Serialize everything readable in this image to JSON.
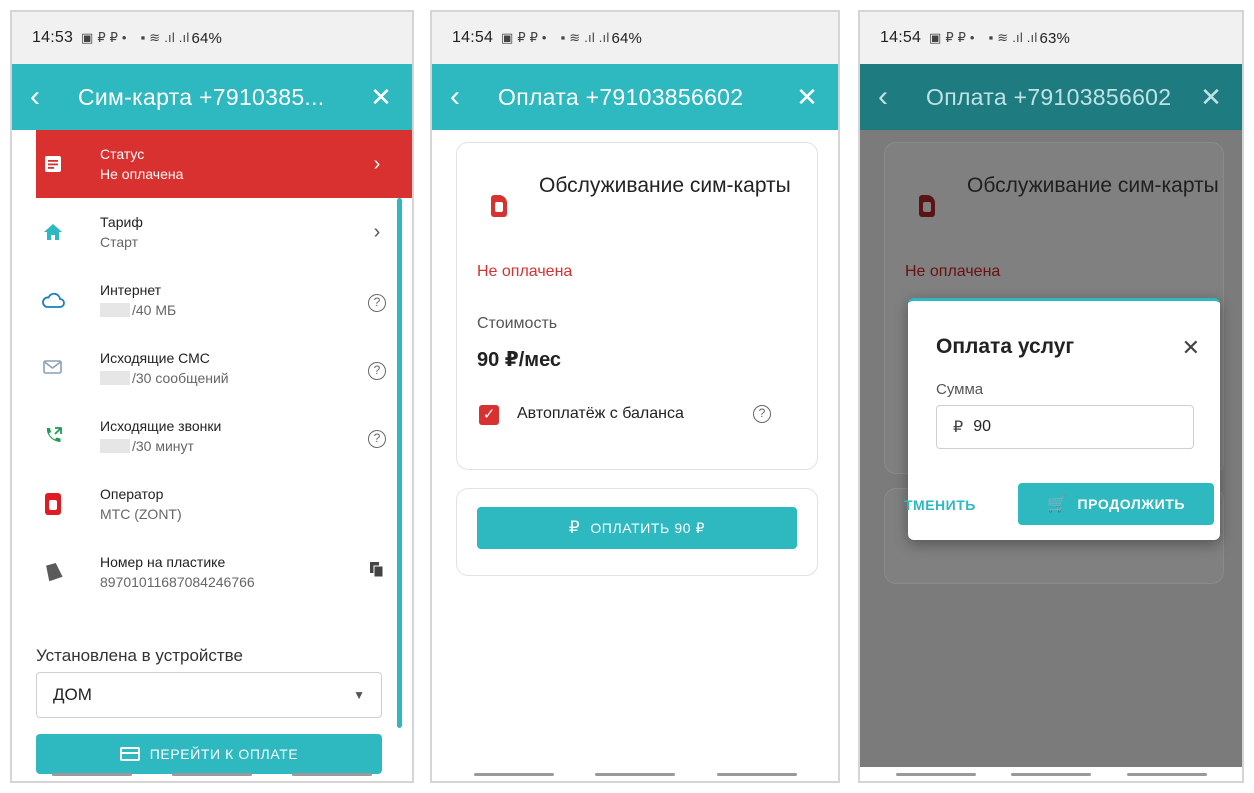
{
  "screen1": {
    "statusbar": {
      "time": "14:53",
      "battery": "64%"
    },
    "appbar": {
      "title": "Сим-карта +7910385..."
    },
    "rows": [
      {
        "l1": "Статус",
        "l2": "Не оплачена"
      },
      {
        "l1": "Тариф",
        "l2": "Старт"
      },
      {
        "l1": "Интернет",
        "l2": "/40 МБ"
      },
      {
        "l1": "Исходящие СМС",
        "l2": "/30 сообщений"
      },
      {
        "l1": "Исходящие звонки",
        "l2": "/30 минут"
      },
      {
        "l1": "Оператор",
        "l2": "МТС (ZONT)"
      },
      {
        "l1": "Номер на пластике",
        "l2": "89701011687084246766"
      }
    ],
    "device_label": "Установлена в устройстве",
    "device_value": "ДОМ",
    "pay_button": "ПЕРЕЙТИ К ОПЛАТЕ"
  },
  "screen2": {
    "statusbar": {
      "time": "14:54",
      "battery": "64%"
    },
    "appbar": {
      "title": "Оплата +79103856602"
    },
    "service_title": "Обслуживание сим-карты",
    "status": "Не оплачена",
    "cost_label": "Стоимость",
    "cost_value": "90 ₽/мес",
    "autopay_label": "Автоплатёж с баланса",
    "pay_button": "ОПЛАТИТЬ 90 ₽"
  },
  "screen3": {
    "statusbar": {
      "time": "14:54",
      "battery": "63%"
    },
    "appbar": {
      "title": "Оплата +79103856602"
    },
    "service_title": "Обслуживание сим-карты",
    "status": "Не оплачена",
    "dialog": {
      "title": "Оплата услуг",
      "amount_label": "Сумма",
      "currency": "₽",
      "amount_value": "90",
      "cancel": "ТМЕНИТЬ",
      "continue": "ПРОДОЛЖИТЬ"
    }
  },
  "colors": {
    "accent": "#2eb8bf",
    "danger": "#d9312f"
  }
}
